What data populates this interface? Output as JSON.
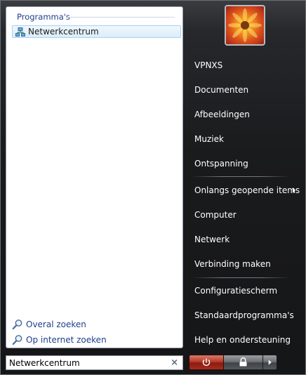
{
  "left_pane": {
    "section_header": "Programma's",
    "programs": [
      {
        "label": "Netwerkcentrum",
        "icon": "network-center-icon"
      }
    ],
    "search_links": [
      {
        "label": "Overal zoeken",
        "icon": "search-icon"
      },
      {
        "label": "Op internet zoeken",
        "icon": "search-icon"
      }
    ]
  },
  "search": {
    "value": "Netwerkcentrum",
    "clear_label": "×"
  },
  "right_pane": {
    "items": [
      {
        "label": "VPNXS"
      },
      {
        "label": "Documenten"
      },
      {
        "label": "Afbeeldingen"
      },
      {
        "label": "Muziek"
      },
      {
        "label": "Ontspanning"
      },
      {
        "label": "Onlangs geopende items"
      },
      {
        "label": "Computer"
      },
      {
        "label": "Netwerk"
      },
      {
        "label": "Verbinding maken"
      },
      {
        "label": "Configuratiescherm"
      },
      {
        "label": "Standaardprogramma's"
      },
      {
        "label": "Help en ondersteuning"
      }
    ]
  },
  "power": {
    "power_icon": "power-icon",
    "lock_icon": "lock-icon",
    "more_icon": "arrow-right-icon"
  },
  "colors": {
    "menu_background": "#1a1b1d",
    "left_pane_background": "#ffffff",
    "header_text": "#1e3f8c",
    "selected_item_border": "#a8d3f0",
    "power_button": "#b63a2a"
  }
}
